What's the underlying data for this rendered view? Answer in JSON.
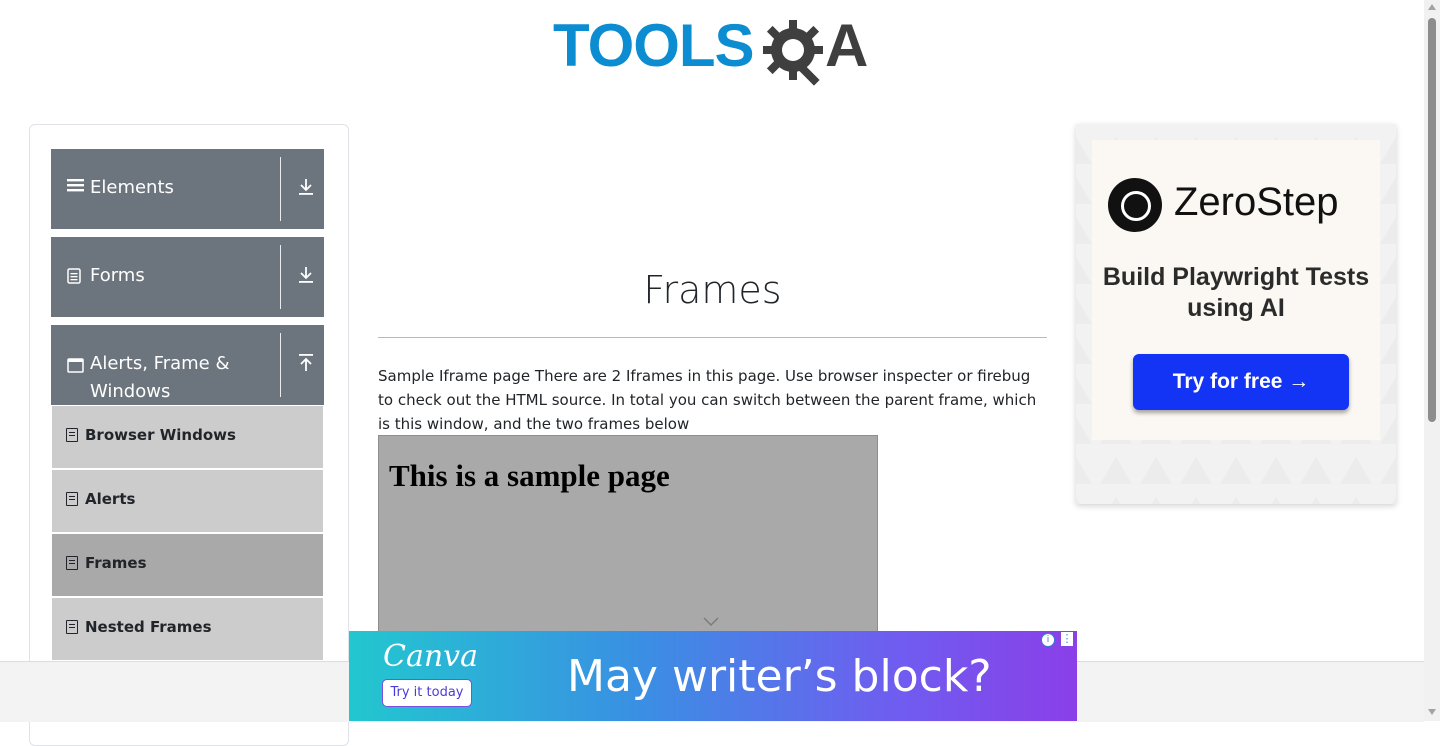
{
  "header": {
    "logo_blue_text": "TOOLS",
    "logo_dark_text": "A"
  },
  "sidebar": {
    "groups": [
      {
        "label": "Elements",
        "icon": "hamburger-icon",
        "toggle": "download-arrow-icon"
      },
      {
        "label": "Forms",
        "icon": "document-icon",
        "toggle": "download-arrow-icon"
      },
      {
        "label": "Alerts, Frame & Windows",
        "icon": "window-icon",
        "toggle": "upload-arrow-icon"
      }
    ],
    "items": [
      {
        "label": "Browser Windows",
        "active": false
      },
      {
        "label": "Alerts",
        "active": false
      },
      {
        "label": "Frames",
        "active": true
      },
      {
        "label": "Nested Frames",
        "active": false
      }
    ]
  },
  "main": {
    "title": "Frames",
    "intro": "Sample Iframe page There are 2 Iframes in this page. Use browser inspecter or firebug to check out the HTML source. In total you can switch between the parent frame, which is this window, and the two frames below",
    "frame_heading": "This is a sample page"
  },
  "ad_right": {
    "brand": "ZeroStep",
    "tagline": "Build Playwright Tests using AI",
    "cta": "Try for free →",
    "button_color": "#1434f5"
  },
  "ad_bottom": {
    "brand": "Canva",
    "cta": "Try it today",
    "headline": "May writer’s block?"
  },
  "colors": {
    "sidebar_header": "#6c757d",
    "menu_item": "#cccccc",
    "menu_item_active": "#a9a9a9",
    "logo_blue": "#0c8cd1"
  }
}
